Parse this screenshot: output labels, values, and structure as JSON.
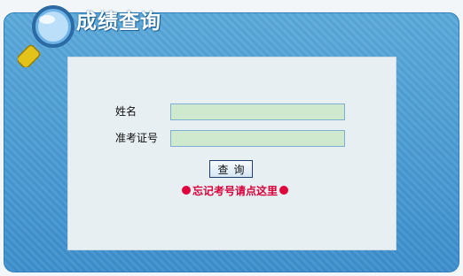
{
  "header": {
    "title": "成绩查询"
  },
  "form": {
    "name_label": "姓名",
    "name_value": "",
    "ticket_label": "准考证号",
    "ticket_value": "",
    "submit_label": "查询",
    "forgot_link": "忘记考号请点这里"
  },
  "colors": {
    "frame": "#3d8fcd",
    "panel": "#e8eff2",
    "input_bg": "#cfe9cf",
    "link": "#d7003a"
  },
  "icons": [
    "magnifier-icon",
    "bullet-dot-icon"
  ]
}
